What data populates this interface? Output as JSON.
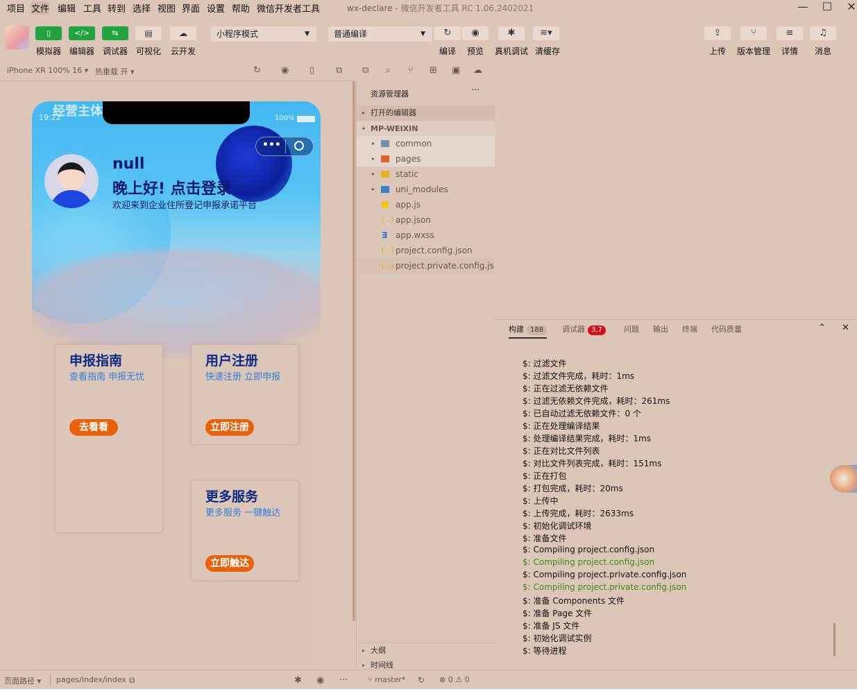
{
  "menu": [
    "项目",
    "文件",
    "编辑",
    "工具",
    "转到",
    "选择",
    "视图",
    "界面",
    "设置",
    "帮助",
    "微信开发者工具"
  ],
  "window_title": {
    "project": "wx-declare",
    "sep": " - ",
    "app": "微信开发者工具 RC 1.06.2402021"
  },
  "toolbar": {
    "left_buttons": [
      "模拟器",
      "编辑器",
      "调试器",
      "可视化",
      "云开发"
    ],
    "mode_select": "小程序模式",
    "compile_select": "普通编译",
    "actions": [
      "编译",
      "预览",
      "真机调试",
      "清缓存"
    ],
    "right_buttons": [
      "上传",
      "版本管理",
      "详情",
      "消息"
    ]
  },
  "simbar": {
    "device": "iPhone XR 100% 16",
    "hot_reload": "热重载 开"
  },
  "phone": {
    "top_text": "经营主体",
    "time": "19:22",
    "battery": "100%",
    "username": "null",
    "greeting": "晚上好!  点击登录",
    "welcome": "欢迎来到企业住所登记申报承诺平台",
    "cards": [
      {
        "title": "申报指南",
        "desc": "查看指南 申报无忧",
        "button": "去看看"
      },
      {
        "title": "用户注册",
        "desc": "快速注册 立即申报",
        "button": "立即注册"
      },
      {
        "title": "更多服务",
        "desc": "更多服务 一键触达",
        "button": "立即触达"
      }
    ]
  },
  "explorer": {
    "title": "资源管理器",
    "more": "···",
    "open_editors": "打开的编辑器",
    "root": "MP-WEIXIN",
    "items": [
      "common",
      "pages",
      "static",
      "uni_modules",
      "app.js",
      "app.json",
      "app.wxss",
      "project.config.json",
      "project.private.config.js..."
    ],
    "outline": "大纲",
    "timeline": "时间线"
  },
  "console": {
    "tabs": [
      "构建",
      "调试器",
      "问题",
      "输出",
      "终端",
      "代码质量"
    ],
    "build_count": "188",
    "debug_count": "3,7",
    "logs": [
      {
        "text": "$: 过滤文件",
        "green": false
      },
      {
        "text": "$: 过滤文件完成，耗时：1ms",
        "green": false
      },
      {
        "text": "$: 正在过滤无依赖文件",
        "green": false
      },
      {
        "text": "$: 过滤无依赖文件完成，耗时：261ms",
        "green": false
      },
      {
        "text": "$: 已自动过滤无依赖文件：0 个",
        "green": false
      },
      {
        "text": "$: 正在处理编译结果",
        "green": false
      },
      {
        "text": "$: 处理编译结果完成，耗时：1ms",
        "green": false
      },
      {
        "text": "$: 正在对比文件列表",
        "green": false
      },
      {
        "text": "$: 对比文件列表完成，耗时：151ms",
        "green": false
      },
      {
        "text": "$: 正在打包",
        "green": false
      },
      {
        "text": "$: 打包完成，耗时：20ms",
        "green": false
      },
      {
        "text": "$: 上传中",
        "green": false
      },
      {
        "text": "$: 上传完成，耗时：2633ms",
        "green": false
      },
      {
        "text": "$: 初始化调试环境",
        "green": false
      },
      {
        "text": "$: 准备文件",
        "green": false
      },
      {
        "text": "$: Compiling project.config.json",
        "green": false
      },
      {
        "text": "$: Compiling project.config.json",
        "green": true
      },
      {
        "text": "$: Compiling project.private.config.json",
        "green": false
      },
      {
        "text": "$: Compiling project.private.config.json",
        "green": true
      },
      {
        "text": "$: 准备 Components 文件",
        "green": false
      },
      {
        "text": "$: 准备 Page 文件",
        "green": false
      },
      {
        "text": "$: 准备 JS 文件",
        "green": false
      },
      {
        "text": "$: 初始化调试实例",
        "green": false
      },
      {
        "text": "$: 等待进程",
        "green": false
      }
    ]
  },
  "status": {
    "page_path_label": "页面路径",
    "page_path": "pages/index/index",
    "branch": "master*",
    "errors": "0",
    "warnings": "0"
  },
  "colors": {
    "accent_green": "#21a33f",
    "orange": "#e8620c",
    "navy": "#0d2a86",
    "link_blue": "#2f7fd8"
  }
}
